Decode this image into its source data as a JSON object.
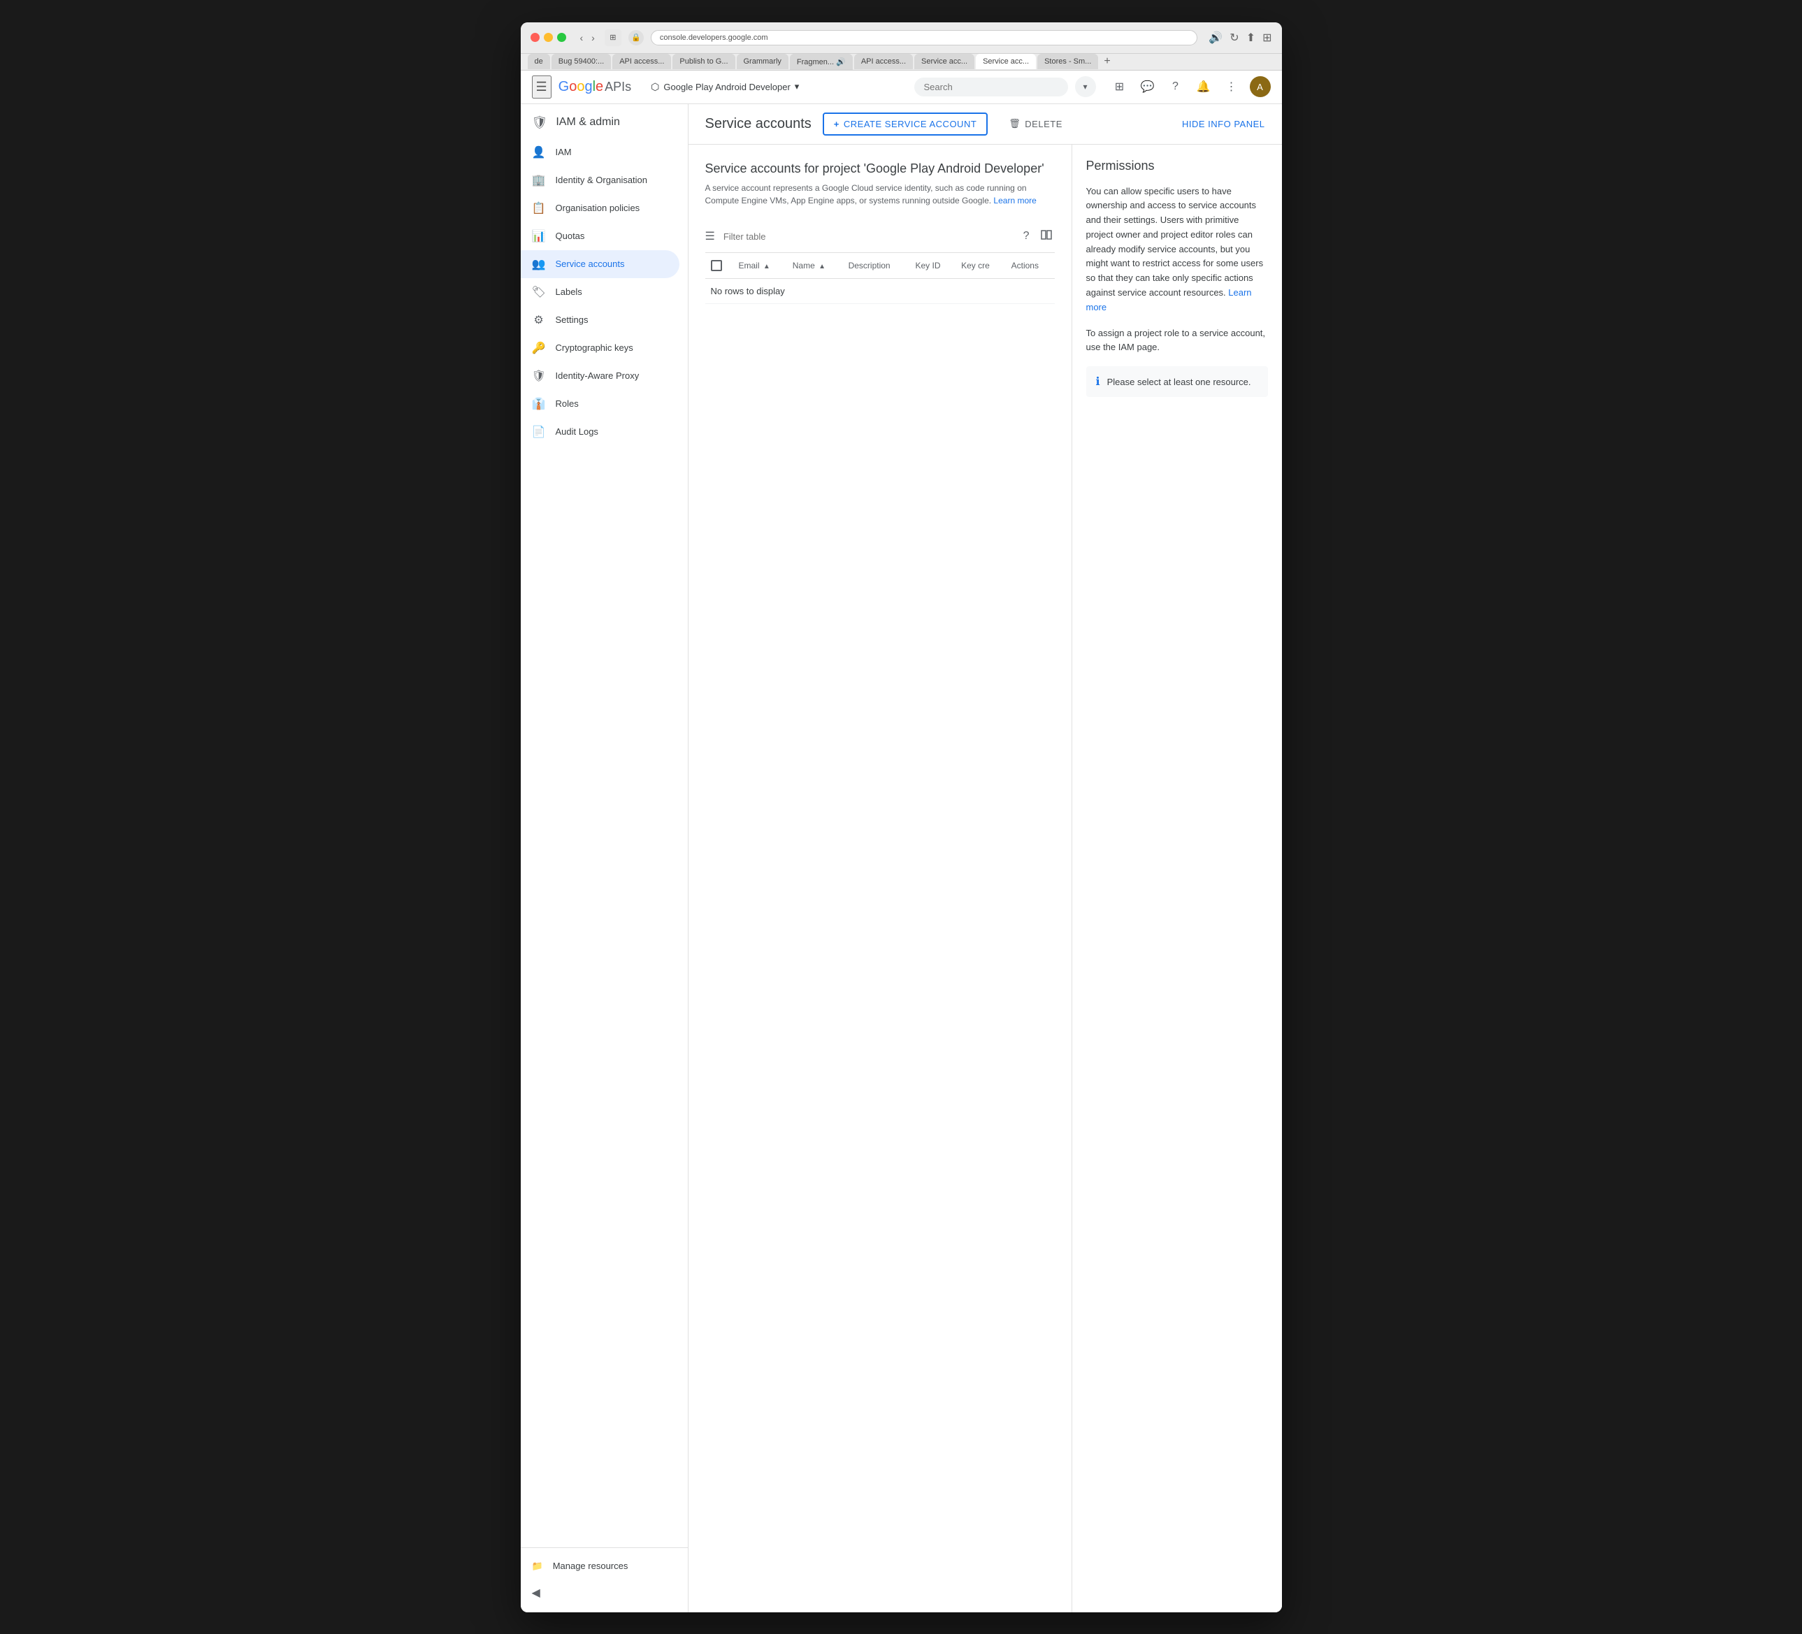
{
  "browser": {
    "traffic_lights": [
      "red",
      "yellow",
      "green"
    ],
    "address": "console.developers.google.com",
    "tabs": [
      {
        "label": "de",
        "active": false
      },
      {
        "label": "Bug 59400:...",
        "active": false
      },
      {
        "label": "API access...",
        "active": false
      },
      {
        "label": "Publish to G...",
        "active": false
      },
      {
        "label": "Grammarly",
        "active": false
      },
      {
        "label": "Fragmen... 🔊",
        "active": false
      },
      {
        "label": "API access...",
        "active": false
      },
      {
        "label": "Service acc...",
        "active": false
      },
      {
        "label": "Service acc...",
        "active": true
      },
      {
        "label": "Stores - Sm...",
        "active": false
      }
    ]
  },
  "app_header": {
    "google_text": "Google",
    "apis_text": "APIs",
    "project_name": "Google Play Android Developer",
    "search_placeholder": "Search"
  },
  "sidebar": {
    "title": "IAM & admin",
    "nav_items": [
      {
        "label": "IAM",
        "icon": "person-icon",
        "active": false
      },
      {
        "label": "Identity & Organisation",
        "icon": "domain-icon",
        "active": false
      },
      {
        "label": "Organisation policies",
        "icon": "list-icon",
        "active": false
      },
      {
        "label": "Quotas",
        "icon": "chart-icon",
        "active": false
      },
      {
        "label": "Service accounts",
        "icon": "account-icon",
        "active": true
      },
      {
        "label": "Labels",
        "icon": "label-icon",
        "active": false
      },
      {
        "label": "Settings",
        "icon": "settings-icon",
        "active": false
      },
      {
        "label": "Cryptographic keys",
        "icon": "key-icon",
        "active": false
      },
      {
        "label": "Identity-Aware Proxy",
        "icon": "shield-icon",
        "active": false
      },
      {
        "label": "Roles",
        "icon": "roles-icon",
        "active": false
      },
      {
        "label": "Audit Logs",
        "icon": "logs-icon",
        "active": false
      }
    ],
    "bottom_items": [
      {
        "label": "Manage resources",
        "icon": "manage-icon"
      }
    ]
  },
  "page": {
    "title": "Service accounts",
    "create_button": "CREATE SERVICE ACCOUNT",
    "delete_button": "DELETE",
    "hide_panel_button": "HIDE INFO PANEL",
    "service_accounts_title": "Service accounts for project 'Google Play Android Developer'",
    "service_accounts_desc": "A service account represents a Google Cloud service identity, such as code running on Compute Engine VMs, App Engine apps, or systems running outside Google.",
    "learn_more_text": "Learn more",
    "table": {
      "filter_placeholder": "Filter table",
      "columns": [
        {
          "label": "Email",
          "sortable": true
        },
        {
          "label": "Name",
          "sortable": true
        },
        {
          "label": "Description",
          "sortable": false
        },
        {
          "label": "Key ID",
          "sortable": false
        },
        {
          "label": "Key cre",
          "sortable": false
        },
        {
          "label": "Actions",
          "sortable": false
        }
      ],
      "no_rows_text": "No rows to display"
    },
    "info_panel": {
      "title": "Permissions",
      "text1": "You can allow specific users to have ownership and access to service accounts and their settings. Users with primitive project owner and project editor roles can already modify service accounts, but you might want to restrict access for some users so that they can take only specific actions against service account resources.",
      "learn_more_text": "Learn more",
      "text2": "To assign a project role to a service account, use the IAM page.",
      "info_box_text": "Please select at least one resource."
    }
  }
}
